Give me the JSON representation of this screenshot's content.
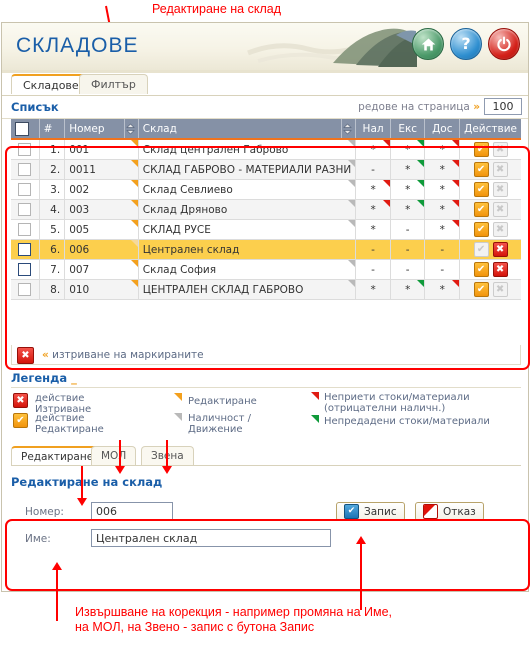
{
  "annotations": {
    "top_note": "Редактиране на склад",
    "bottom_note_line1": "Извършване на корекция - например промяна на Име,",
    "bottom_note_line2": "на МОЛ, на Звено - запис с бутона Запис",
    "color": "#ff0000"
  },
  "header": {
    "title": "СКЛАДОВЕ",
    "icons": [
      {
        "name": "home-icon",
        "glyph": "⌂",
        "color": "#4c9a6a"
      },
      {
        "name": "help-icon",
        "glyph": "?",
        "color": "#2f8fd0"
      },
      {
        "name": "power-icon",
        "glyph": "⏻",
        "color": "#d4211a"
      }
    ]
  },
  "tabs": [
    {
      "label": "Складове",
      "active": true
    },
    {
      "label": "Филтър",
      "active": false
    }
  ],
  "list_section": {
    "title": "Списък",
    "rows_per_page_label": "редове на страница",
    "rows_per_page_value": "100"
  },
  "table": {
    "columns": [
      "",
      "#",
      "Номер",
      "Склад",
      "Нал",
      "Екс",
      "Доc",
      "Действие"
    ],
    "headers": {
      "checkbox": "",
      "index": "#",
      "number": "Номер",
      "warehouse": "Склад",
      "nal": "Нал",
      "eks": "Екс",
      "dos": "Доc",
      "action": "Действие"
    },
    "rows": [
      {
        "index": "1.",
        "number": "001",
        "warehouse": "Склад централен Габрово",
        "nal": "*",
        "eks": "*",
        "dos": "*",
        "nal_flag": "red",
        "eks_flag": "grn",
        "dos_flag": "red",
        "edit": "enabled",
        "delete": "disabled",
        "selected": false,
        "checked": false
      },
      {
        "index": "2.",
        "number": "0011",
        "warehouse": "СКЛАД ГАБРОВО - МАТЕРИАЛИ РАЗНИ",
        "nal": "-",
        "eks": "*",
        "dos": "*",
        "nal_flag": "none",
        "eks_flag": "grn",
        "dos_flag": "red",
        "edit": "enabled",
        "delete": "disabled",
        "selected": false,
        "checked": false
      },
      {
        "index": "3.",
        "number": "002",
        "warehouse": "Склад Севлиево",
        "nal": "*",
        "eks": "*",
        "dos": "*",
        "nal_flag": "red",
        "eks_flag": "grn",
        "dos_flag": "red",
        "edit": "enabled",
        "delete": "disabled",
        "selected": false,
        "checked": false
      },
      {
        "index": "4.",
        "number": "003",
        "warehouse": "Склад Дряново",
        "nal": "*",
        "eks": "*",
        "dos": "*",
        "nal_flag": "red",
        "eks_flag": "grn",
        "dos_flag": "red",
        "edit": "enabled",
        "delete": "disabled",
        "selected": false,
        "checked": false
      },
      {
        "index": "5.",
        "number": "005",
        "warehouse": "СКЛАД РУСЕ",
        "nal": "*",
        "eks": "-",
        "dos": "*",
        "nal_flag": "none",
        "eks_flag": "none",
        "dos_flag": "red",
        "edit": "enabled",
        "delete": "disabled",
        "selected": false,
        "checked": false
      },
      {
        "index": "6.",
        "number": "006",
        "warehouse": "Централен склад",
        "nal": "-",
        "eks": "-",
        "dos": "-",
        "nal_flag": "none",
        "eks_flag": "none",
        "dos_flag": "none",
        "edit": "disabled",
        "delete": "enabled",
        "selected": true,
        "checked": true
      },
      {
        "index": "7.",
        "number": "007",
        "warehouse": "Склад София",
        "nal": "-",
        "eks": "-",
        "dos": "-",
        "nal_flag": "none",
        "eks_flag": "none",
        "dos_flag": "none",
        "edit": "enabled",
        "delete": "enabled",
        "selected": false,
        "checked": true
      },
      {
        "index": "8.",
        "number": "010",
        "warehouse": "ЦЕНТРАЛЕН СКЛАД ГАБРОВО",
        "nal": "*",
        "eks": "*",
        "dos": "*",
        "nal_flag": "none",
        "eks_flag": "grn",
        "dos_flag": "red",
        "edit": "enabled",
        "delete": "disabled",
        "selected": false,
        "checked": false
      }
    ]
  },
  "delete_marked": {
    "label": "изтриване на маркираните",
    "chevron": "«"
  },
  "legend": {
    "title": "Легенда",
    "items": [
      {
        "name": "legend-delete",
        "line1": "действие",
        "line2": "Изтриване"
      },
      {
        "name": "legend-edit",
        "line1": "действие",
        "line2": "Редактиране"
      },
      {
        "name": "legend-corner-edit",
        "line1": "Редактиране",
        "line2": ""
      },
      {
        "name": "legend-corner-stock",
        "line1": "Наличност /",
        "line2": "Движение"
      },
      {
        "name": "legend-corner-red",
        "line1": "Неприети стоки/материали",
        "line2": "(отрицателни наличн.)"
      },
      {
        "name": "legend-corner-green",
        "line1": "Непредадени стоки/материали",
        "line2": ""
      }
    ]
  },
  "bottom_tabs": [
    {
      "label": "Редактиране",
      "active": true
    },
    {
      "label": "МОЛ",
      "active": false
    },
    {
      "label": "Звена",
      "active": false
    }
  ],
  "edit_form": {
    "title": "Редактиране на склад",
    "number_label": "Номер:",
    "number_value": "006",
    "name_label": "Име:",
    "name_value": "Централен склад",
    "save_label": "Запис",
    "cancel_label": "Отказ"
  },
  "colors": {
    "accent_orange": "#f0731e",
    "brand_blue": "#1a5ea8",
    "header_row": "#8591a6",
    "selected_row": "#fccf4d",
    "annotation_red": "#ff0000"
  }
}
